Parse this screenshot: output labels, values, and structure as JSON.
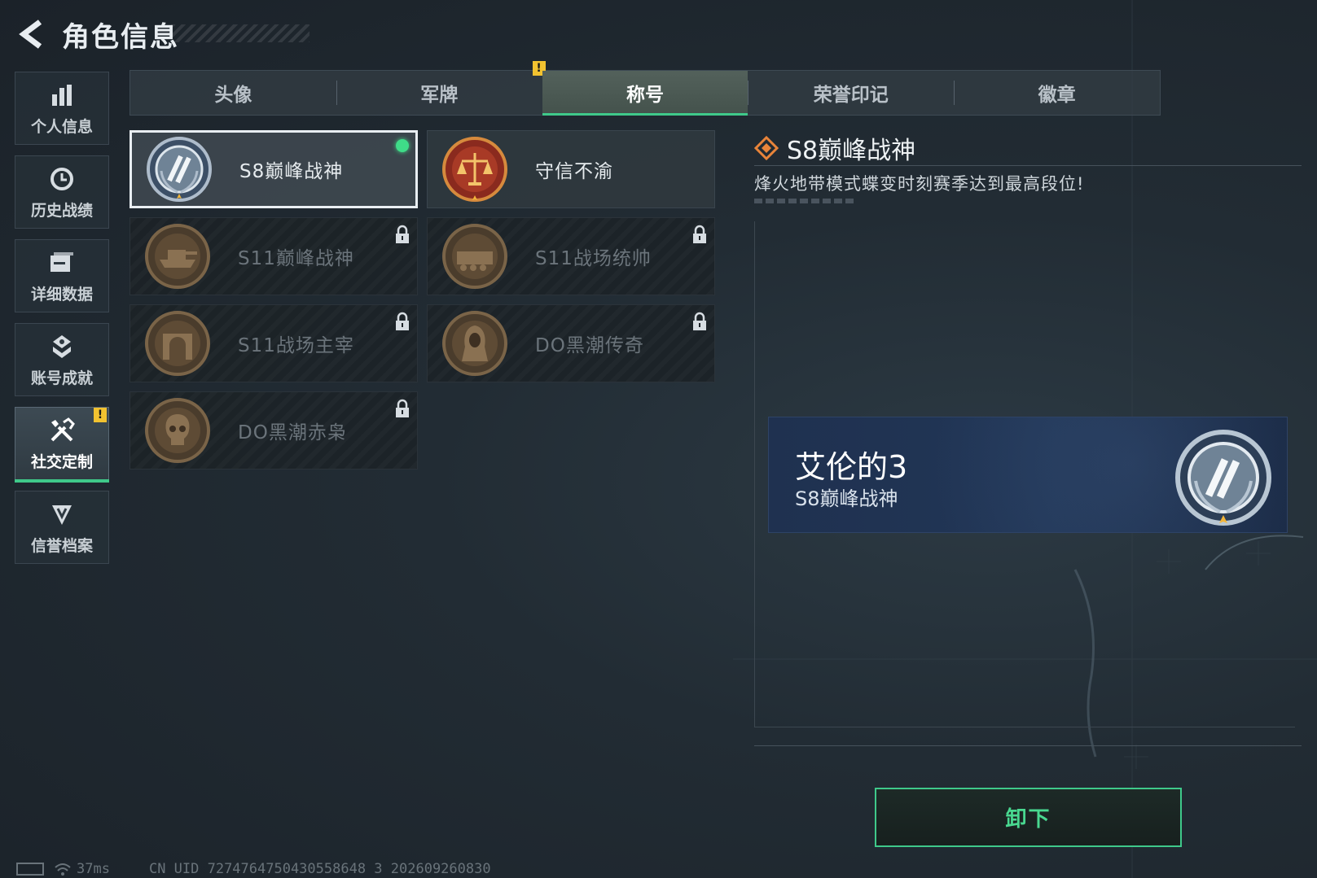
{
  "header": {
    "title": "角色信息"
  },
  "sidebar": {
    "items": [
      {
        "label": "个人信息",
        "icon": "bar-chart-icon"
      },
      {
        "label": "历史战绩",
        "icon": "clock-history-icon"
      },
      {
        "label": "详细数据",
        "icon": "data-stack-icon"
      },
      {
        "label": "账号成就",
        "icon": "achievement-icon"
      },
      {
        "label": "社交定制",
        "icon": "tools-icon",
        "active": true,
        "badge": "!"
      },
      {
        "label": "信誉档案",
        "icon": "credit-shield-icon"
      }
    ]
  },
  "tabs": [
    {
      "label": "头像"
    },
    {
      "label": "军牌",
      "badge": "!"
    },
    {
      "label": "称号",
      "active": true
    },
    {
      "label": "荣誉印记"
    },
    {
      "label": "徽章"
    }
  ],
  "titles": [
    {
      "name": "S8巅峰战神",
      "selected": true,
      "equipped": true,
      "locked": false,
      "medal": "silver-emblem-icon"
    },
    {
      "name": "守信不渝",
      "locked": false,
      "medal": "scales-badge-icon"
    },
    {
      "name": "S11巅峰战神",
      "locked": true,
      "medal": "tank-badge-icon"
    },
    {
      "name": "S11战场统帅",
      "locked": true,
      "medal": "armored-vehicle-badge-icon"
    },
    {
      "name": "S11战场主宰",
      "locked": true,
      "medal": "arch-badge-icon"
    },
    {
      "name": "DO黑潮传奇",
      "locked": true,
      "medal": "hooded-figure-badge-icon"
    },
    {
      "name": "DO黑潮赤枭",
      "locked": true,
      "medal": "skull-badge-icon"
    }
  ],
  "detail": {
    "title": "S8巅峰战神",
    "description": "烽火地带模式蝶变时刻赛季达到最高段位!"
  },
  "preview": {
    "player_name": "艾伦的3",
    "title": "S8巅峰战神"
  },
  "actions": {
    "unequip_label": "卸下"
  },
  "status": {
    "ping": "37ms",
    "uid": "CN UID 7274764750430558648 3  202609260830"
  },
  "colors": {
    "accent": "#3fc98a",
    "warning": "#f2c230",
    "preview_bg": "#213656"
  }
}
